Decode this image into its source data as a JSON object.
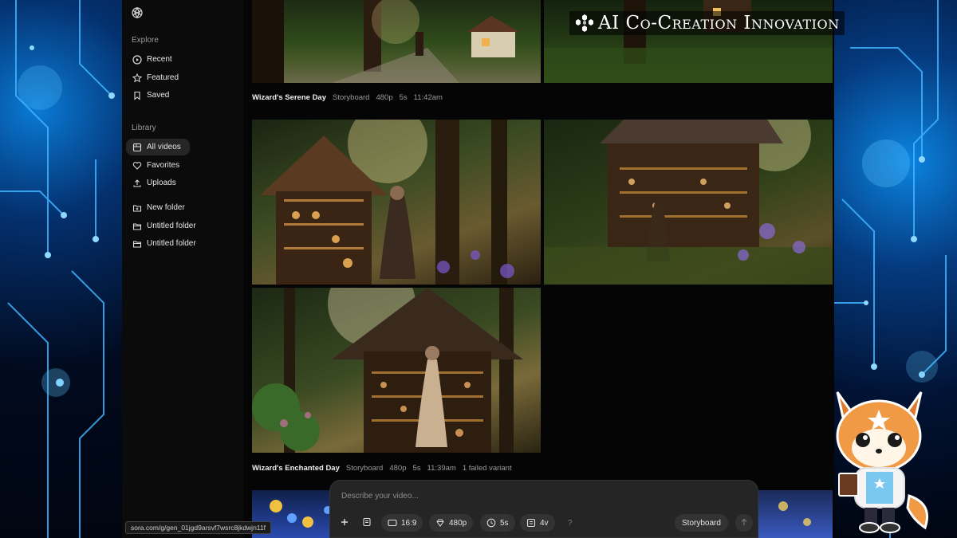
{
  "overlay": {
    "title": "AI Co-Creation Innovation",
    "logo_icon": "hexagon-cluster-icon"
  },
  "sidebar": {
    "logo_icon": "openai-logo-icon",
    "explore_title": "Explore",
    "explore_items": [
      {
        "label": "Recent",
        "icon": "play-circle-icon"
      },
      {
        "label": "Featured",
        "icon": "star-icon"
      },
      {
        "label": "Saved",
        "icon": "bookmark-icon"
      }
    ],
    "library_title": "Library",
    "library_items": [
      {
        "label": "All videos",
        "icon": "grid-icon",
        "active": true
      },
      {
        "label": "Favorites",
        "icon": "heart-icon"
      },
      {
        "label": "Uploads",
        "icon": "upload-icon"
      }
    ],
    "folders": [
      {
        "label": "New folder",
        "icon": "new-folder-icon"
      },
      {
        "label": "Untitled folder",
        "icon": "folder-icon"
      },
      {
        "label": "Untitled folder",
        "icon": "folder-icon"
      }
    ]
  },
  "feed": {
    "groups": [
      {
        "title": "Wizard's Serene Day",
        "type": "Storyboard",
        "resolution": "480p",
        "duration": "5s",
        "time": "11:42am",
        "extra": ""
      },
      {
        "title": "Wizard's Enchanted Day",
        "type": "Storyboard",
        "resolution": "480p",
        "duration": "5s",
        "time": "11:39am",
        "extra": "1 failed variant"
      }
    ]
  },
  "composer": {
    "placeholder": "Describe your video...",
    "aspect": "16:9",
    "resolution": "480p",
    "duration": "5s",
    "variants": "4v",
    "help": "?",
    "storyboard_label": "Storyboard"
  },
  "status_url": "sora.com/g/gen_01jgd9arsvf7wsrc8jkdwjn11f",
  "colors": {
    "accent_blue": "#0a7bd6",
    "panel": "#252525",
    "sidebar_bg": "#0b0b0b"
  }
}
